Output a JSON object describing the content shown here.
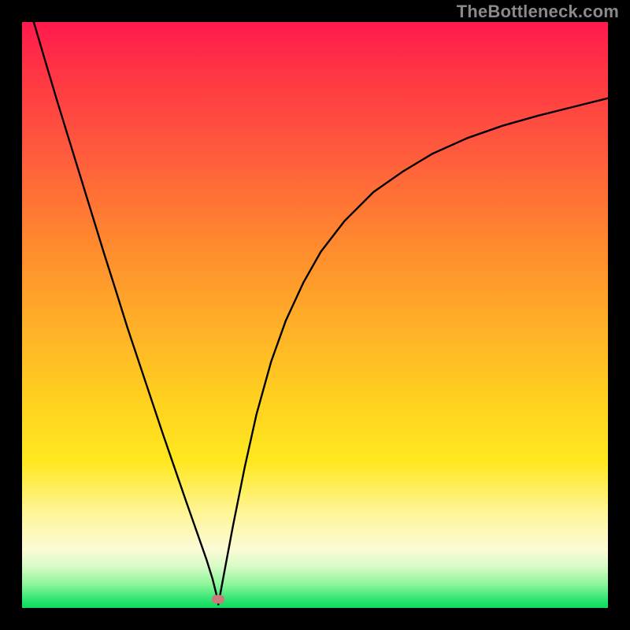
{
  "watermark": "TheBottleneck.com",
  "chart_data": {
    "type": "line",
    "title": "",
    "xlabel": "",
    "ylabel": "",
    "xlim": [
      0,
      1
    ],
    "ylim": [
      0,
      1
    ],
    "grid": false,
    "legend": false,
    "background": "rainbow-gradient-red-to-green-vertical",
    "marker": {
      "x": 0.335,
      "y": 0.015,
      "shape": "pill",
      "color": "#cc7a7a"
    },
    "series": [
      {
        "name": "bottleneck-curve",
        "x": [
          0.0,
          0.02,
          0.04,
          0.06,
          0.08,
          0.1,
          0.12,
          0.14,
          0.16,
          0.18,
          0.2,
          0.22,
          0.24,
          0.26,
          0.28,
          0.3,
          0.315,
          0.325,
          0.332,
          0.335,
          0.338,
          0.345,
          0.36,
          0.38,
          0.4,
          0.425,
          0.45,
          0.48,
          0.51,
          0.55,
          0.6,
          0.65,
          0.7,
          0.76,
          0.82,
          0.88,
          0.94,
          1.0
        ],
        "y": [
          1.07,
          1.0,
          0.932,
          0.865,
          0.8,
          0.735,
          0.67,
          0.605,
          0.542,
          0.478,
          0.418,
          0.358,
          0.298,
          0.24,
          0.182,
          0.125,
          0.082,
          0.05,
          0.022,
          0.006,
          0.022,
          0.06,
          0.14,
          0.24,
          0.33,
          0.42,
          0.49,
          0.555,
          0.608,
          0.66,
          0.71,
          0.745,
          0.775,
          0.802,
          0.823,
          0.84,
          0.855,
          0.87
        ],
        "color": "#000000"
      }
    ]
  },
  "colors": {
    "watermark": "#8a8a8a",
    "frame": "#000000"
  }
}
